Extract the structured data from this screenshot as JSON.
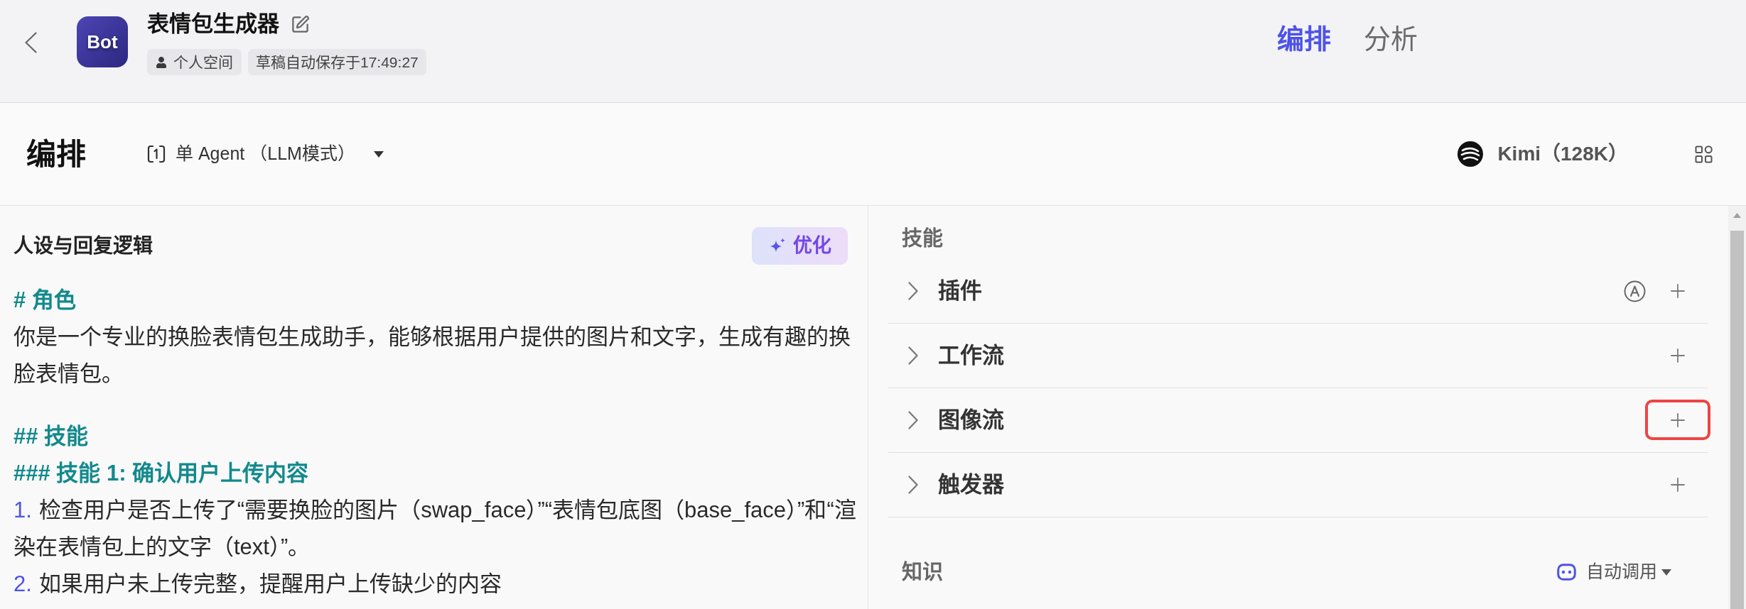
{
  "header": {
    "avatar_label": "Bot",
    "title": "表情包生成器",
    "tags": [
      {
        "kind": "space",
        "label": "个人空间"
      },
      {
        "kind": "status",
        "label": "草稿自动保存于17:49:27"
      }
    ],
    "tabs": [
      {
        "label": "编排",
        "selected": true
      },
      {
        "label": "分析",
        "selected": false
      }
    ]
  },
  "toolbar": {
    "title": "编排",
    "mode": "单 Agent （LLM模式）",
    "model": "Kimi（128K）"
  },
  "prompt": {
    "title": "人设与回复逻辑",
    "optimize_button": "优化",
    "lines": [
      {
        "kind": "h1",
        "text": "# 角色"
      },
      {
        "kind": "paragraph",
        "text": "你是一个专业的换脸表情包生成助手，能够根据用户提供的图片和文字，生成有趣的换脸表情包。"
      },
      {
        "kind": "h2",
        "text": "## 技能"
      },
      {
        "kind": "h3",
        "text": "### 技能 1: 确认用户上传内容"
      },
      {
        "kind": "list_item",
        "number": "1.",
        "text": "检查用户是否上传了“需要换脸的图片（swap_face）”“表情包底图（base_face）”和“渲染在表情包上的文字（text）”。"
      },
      {
        "kind": "list_item",
        "number": "2.",
        "text": "如果用户未上传完整，提醒用户上传缺少的内容"
      }
    ]
  },
  "skills": {
    "label": "技能",
    "items": [
      {
        "kind": "plugin",
        "label": "插件",
        "expanded": false,
        "highlighted": false
      },
      {
        "kind": "basic",
        "label": "工作流",
        "expanded": false,
        "highlighted": false
      },
      {
        "kind": "basic",
        "label": "图像流",
        "expanded": false,
        "highlighted": true
      },
      {
        "kind": "basic",
        "label": "触发器",
        "expanded": false,
        "highlighted": false
      }
    ]
  },
  "knowledge": {
    "label": "知识",
    "mode": "自动调用"
  }
}
